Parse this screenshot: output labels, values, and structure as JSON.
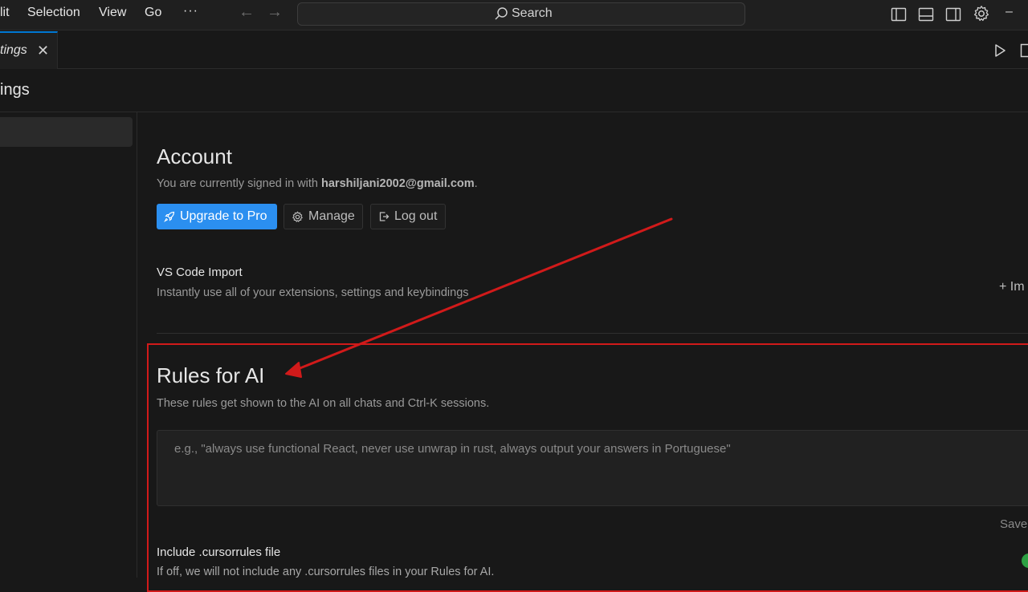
{
  "menu": {
    "edit": "lit",
    "selection": "Selection",
    "view": "View",
    "go": "Go",
    "more": "···"
  },
  "nav": {
    "back": "←",
    "forward": "→"
  },
  "search": {
    "label": "Search"
  },
  "window": {
    "minimize": "–"
  },
  "tab": {
    "label": "tings",
    "close": "✕"
  },
  "page": {
    "title": "ings"
  },
  "account": {
    "title": "Account",
    "signed_in_prefix": "You are currently signed in with ",
    "email": "harshiljani2002@gmail.com",
    "signed_in_suffix": ".",
    "upgrade_label": "Upgrade to Pro",
    "manage_label": "Manage",
    "logout_label": "Log out"
  },
  "vscode_import": {
    "title": "VS Code Import",
    "description": "Instantly use all of your extensions, settings and keybindings",
    "action_label": "+ Im"
  },
  "rules": {
    "title": "Rules for AI",
    "description": "These rules get shown to the AI on all chats and Ctrl-K sessions.",
    "placeholder": "e.g., \"always use functional React, never use unwrap in rust, always output your answers in Portuguese\"",
    "save_label": "Save"
  },
  "cursorrules": {
    "title": "Include .cursorrules file",
    "description": "If off, we will not include any .cursorrules files in your Rules for AI.",
    "enabled": true
  },
  "colors": {
    "accent": "#2b8ff0",
    "annotation": "#d11a1a",
    "toggle_on": "#2ea043"
  }
}
